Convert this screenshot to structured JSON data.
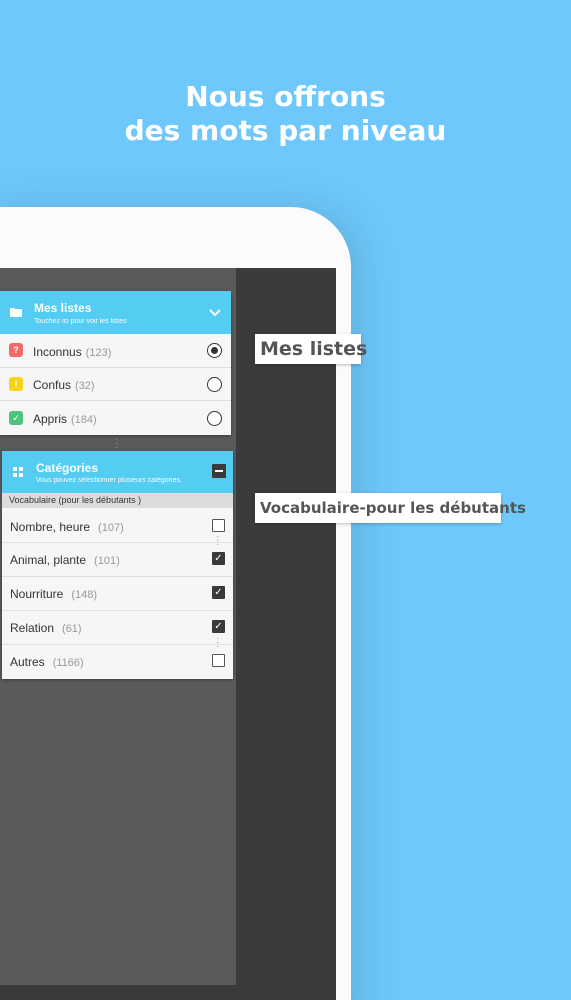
{
  "headline": {
    "line1": "Nous offrons",
    "line2": "des mots par niveau"
  },
  "lists_card": {
    "title": "Mes listes",
    "subtitle": "Touchez ici pour voir les listes",
    "items": [
      {
        "label": "Inconnus",
        "count": "(123)",
        "badge": "?",
        "badge_color": "#f06a6a",
        "selected": true
      },
      {
        "label": "Confus",
        "count": "(32)",
        "badge": "!",
        "badge_color": "#f5d21c",
        "selected": false
      },
      {
        "label": "Appris",
        "count": "(184)",
        "badge": "✓",
        "badge_color": "#4cc47c",
        "selected": false
      }
    ]
  },
  "categories_card": {
    "title": "Catégories",
    "subtitle": "Vous pouvez sélectionner plusieurs catégories.",
    "section": "Vocabulaire (pour les débutants )",
    "items": [
      {
        "label": "Nombre, heure",
        "count": "(107)",
        "checked": false
      },
      {
        "label": "Animal, plante",
        "count": "(101)",
        "checked": true
      },
      {
        "label": "Nourriture",
        "count": "(148)",
        "checked": true
      },
      {
        "label": "Relation",
        "count": "(61)",
        "checked": true
      },
      {
        "label": "Autres",
        "count": "(1166)",
        "checked": false
      }
    ]
  },
  "callouts": {
    "lists": "Mes listes",
    "vocab": "Vocabulaire-pour les débutants"
  },
  "colors": {
    "background": "#6ec8fb",
    "header": "#55cdf2"
  }
}
